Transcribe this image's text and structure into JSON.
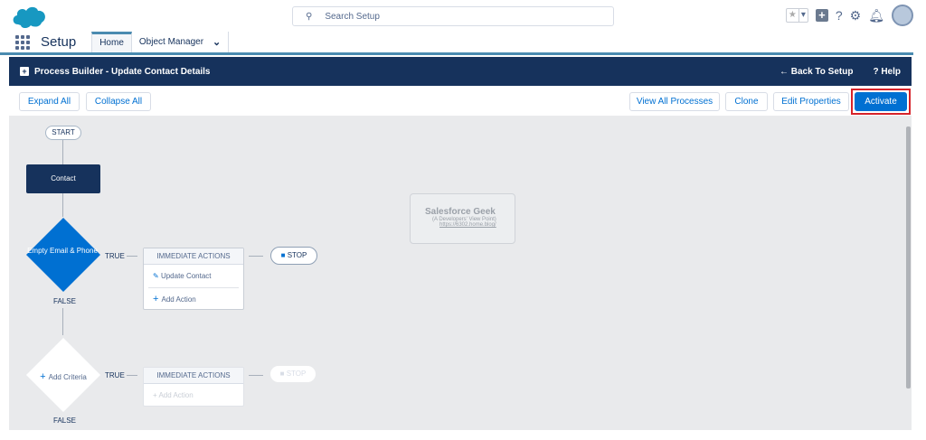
{
  "header": {
    "search_placeholder": "Search Setup",
    "icons": [
      "star-icon",
      "dropdown-icon",
      "plus-icon",
      "help-icon",
      "gear-icon",
      "bell-icon",
      "avatar"
    ]
  },
  "nav": {
    "app": "Setup",
    "tabs": [
      {
        "label": "Home",
        "active": true
      },
      {
        "label": "Object Manager"
      }
    ]
  },
  "band": {
    "title": "Process Builder - Update Contact Details",
    "back": "Back To Setup",
    "help": "Help"
  },
  "toolbar": {
    "expand": "Expand All",
    "collapse": "Collapse All",
    "view_all": "View All Processes",
    "clone": "Clone",
    "edit": "Edit Properties",
    "activate": "Activate"
  },
  "canvas": {
    "start": "START",
    "object": "Contact",
    "criteria1": {
      "label": "Empty Email & Phone",
      "true": "TRUE",
      "false": "FALSE",
      "actions_header": "IMMEDIATE ACTIONS",
      "action": "Update Contact",
      "add_action": "Add Action",
      "stop": "STOP"
    },
    "criteria2": {
      "label": "Add Criteria",
      "true": "TRUE",
      "false": "FALSE",
      "actions_header": "IMMEDIATE ACTIONS",
      "add_action": "Add Action",
      "stop": "STOP"
    },
    "watermark": {
      "title": "Salesforce Geek",
      "subtitle": "(A Developers' View Point)",
      "url": "https://6302.home.blog/"
    }
  },
  "colors": {
    "brand": "#0070d2",
    "navy": "#16325c",
    "highlight": "#d6232a"
  }
}
